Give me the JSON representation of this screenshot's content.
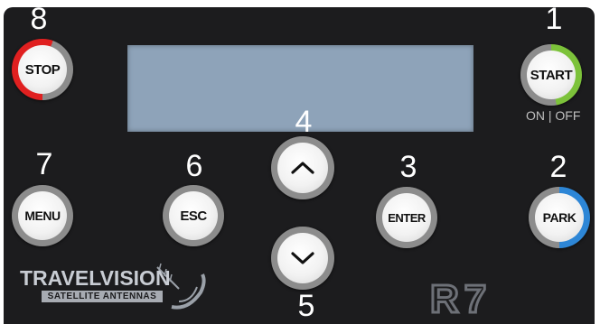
{
  "buttons": {
    "stop": {
      "label": "STOP",
      "number": "8"
    },
    "start": {
      "label": "START",
      "number": "1",
      "sub": "ON | OFF"
    },
    "menu": {
      "label": "MENU",
      "number": "7"
    },
    "esc": {
      "label": "ESC",
      "number": "6"
    },
    "up": {
      "number": "4",
      "icon": "chevron-up-icon"
    },
    "down": {
      "number": "5",
      "icon": "chevron-down-icon"
    },
    "enter": {
      "label": "ENTER",
      "number": "3"
    },
    "park": {
      "label": "PARK",
      "number": "2"
    }
  },
  "brand": {
    "name": "TRAVELVISION",
    "tagline": "SATELLITE ANTENNAS",
    "model": "R7"
  },
  "colors": {
    "panel": "#1c1c1e",
    "lcd": "#8ea3b9",
    "stop_accent": "#e02020",
    "start_accent": "#7cc23a",
    "park_accent": "#2d86d6",
    "ring_gray": "#8c8c8c"
  }
}
